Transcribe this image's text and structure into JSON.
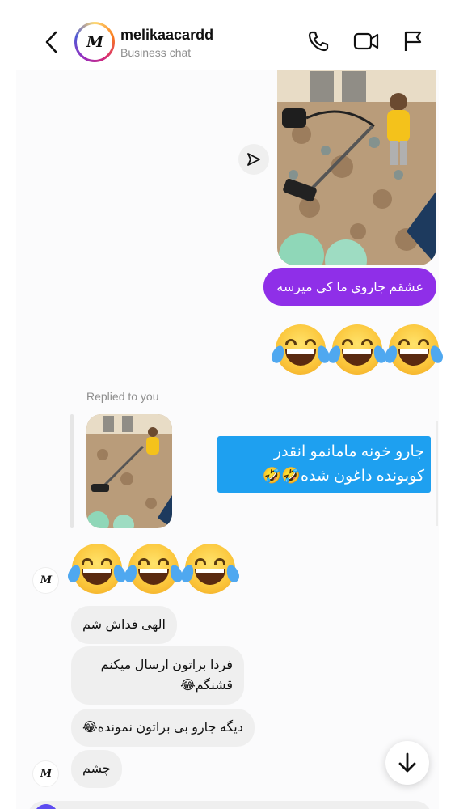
{
  "header": {
    "username": "melikaacardd",
    "subtitle": "Business chat",
    "avatar_logo": "M"
  },
  "icons": {
    "back": "chevron-left-icon",
    "call": "phone-icon",
    "video": "video-camera-icon",
    "report": "flag-icon",
    "share": "send-icon",
    "scroll": "arrow-down-icon"
  },
  "messages": {
    "outgoing_caption": "عشقم جاروي ما كي ميرسه",
    "outgoing_emojis": "😂😂😂",
    "replied_label": "Replied to you",
    "reply_text": "جارو خونه مامانمو انقدر کوبونده داغون شده🤣🤣",
    "incoming_emojis": "😂😂😂",
    "incoming": [
      "الهی فداش شم",
      "فردا براتون  ارسال میکنم قشنگم😂",
      "دیگه جارو بی براتون نمونده😂",
      "چشم"
    ]
  },
  "colors": {
    "outgoing_bubble": "#8f2fe8",
    "reply_bubble": "#1ea0f0",
    "incoming_bubble": "#efefef"
  }
}
